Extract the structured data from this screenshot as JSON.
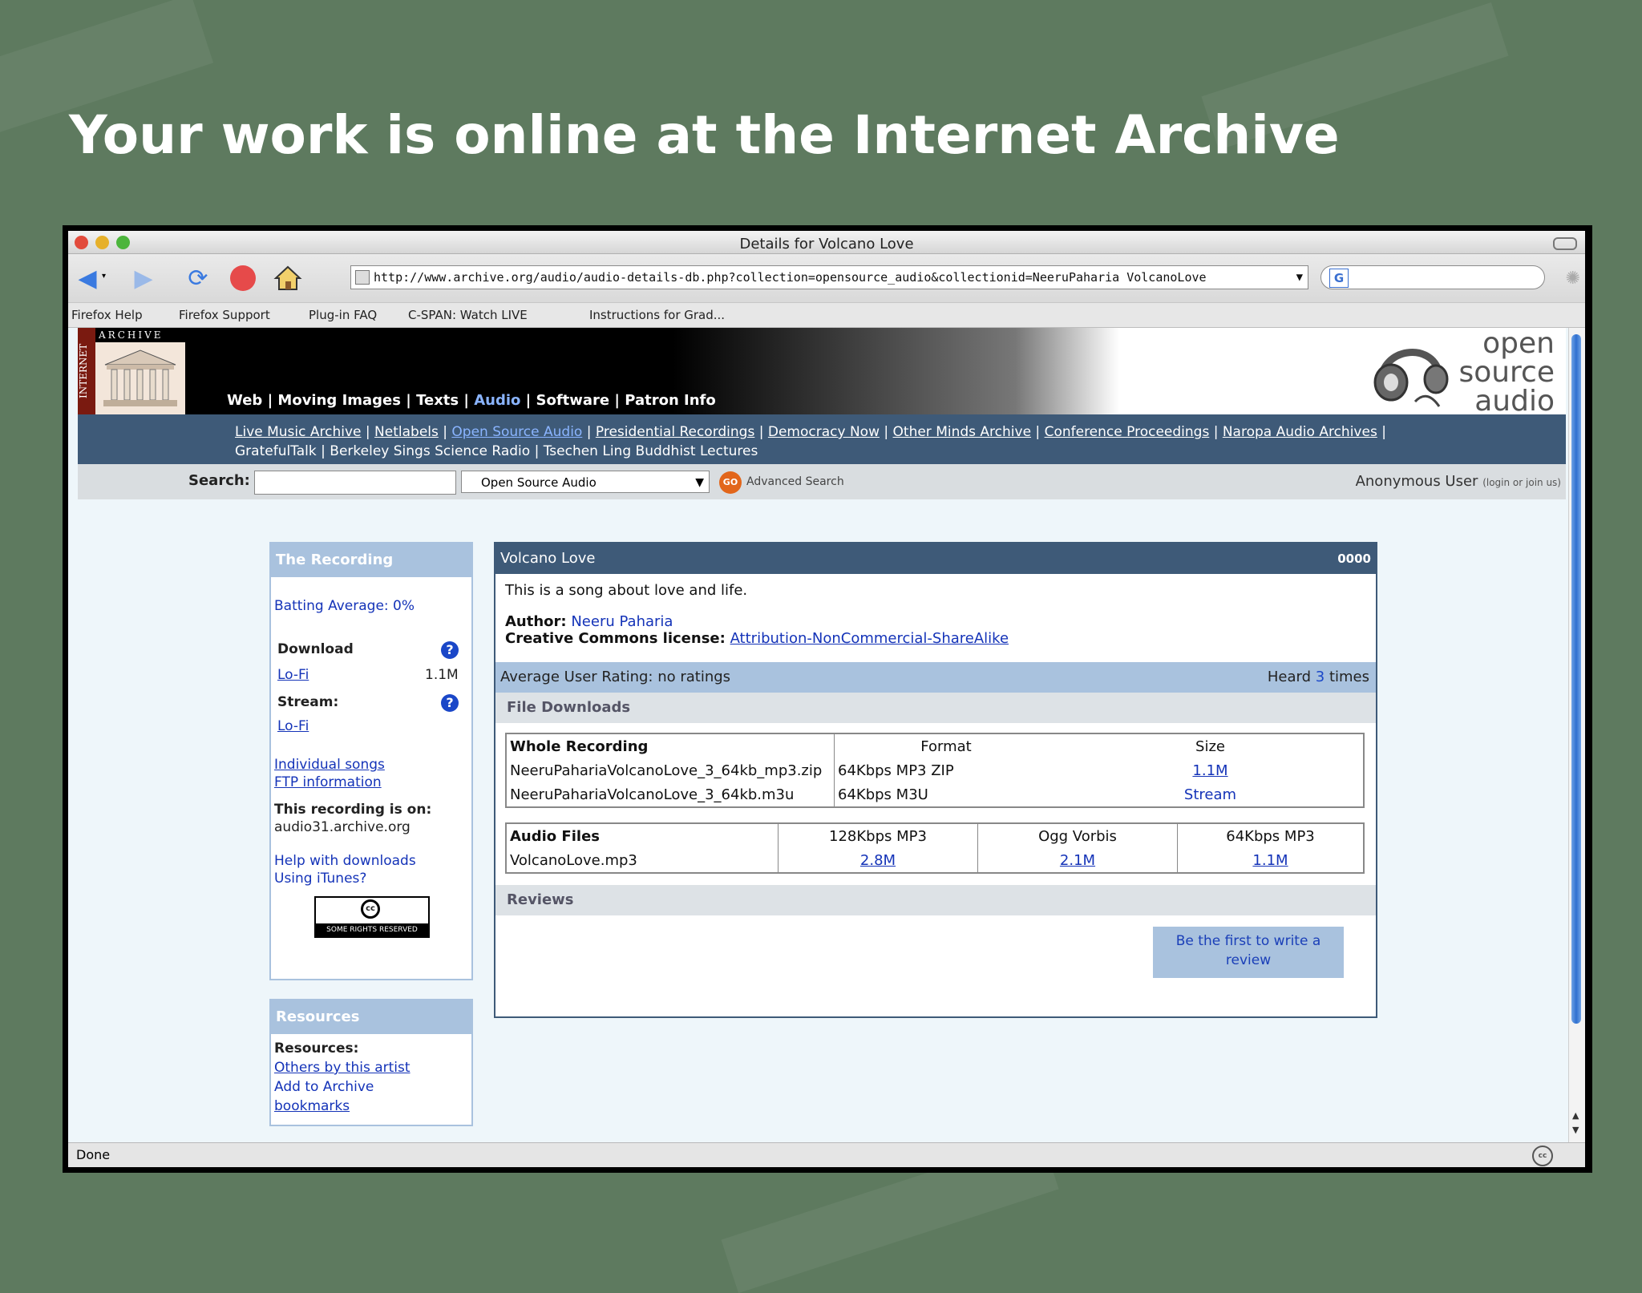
{
  "slide": {
    "title": "Your work is online at the Internet Archive"
  },
  "window": {
    "title": "Details for Volcano Love",
    "url": "http://www.archive.org/audio/audio-details-db.php?collection=opensource_audio&collectionid=NeeruPaharia VolcanoLove",
    "bookmarks": [
      "Firefox Help",
      "Firefox Support",
      "Plug-in FAQ",
      "C-SPAN: Watch LIVE",
      "Instructions for Grad..."
    ],
    "status": "Done",
    "colors": {
      "close": "#e24b3c",
      "minimize": "#e6b02a",
      "zoom": "#4cb53c"
    }
  },
  "site": {
    "logo": {
      "top": "ARCHIVE",
      "side": "INTERNET"
    },
    "nav": [
      "Web",
      "Moving Images",
      "Texts",
      "Audio",
      "Software",
      "Patron Info"
    ],
    "subnav": [
      "Live Music Archive",
      "Netlabels",
      "Open Source Audio",
      "Presidential Recordings",
      "Democracy Now",
      "Other Minds Archive",
      "Conference Proceedings",
      "Naropa Audio Archives",
      "GratefulTalk",
      "Berkeley Sings Science Radio",
      "Tsechen Ling Buddhist Lectures"
    ],
    "osa": {
      "line1": "open",
      "line2": "source",
      "line3": "audio"
    },
    "search": {
      "label": "Search:",
      "collection": "Open Source Audio",
      "go": "GO",
      "advanced": "Advanced Search",
      "user": "Anonymous User",
      "login": "(login or join us)"
    }
  },
  "recording": {
    "header": "The Recording",
    "batting": "Batting Average: 0%",
    "download_label": "Download",
    "lofi": "Lo-Fi",
    "lofi_size": "1.1M",
    "stream_label": "Stream:",
    "stream_lofi": "Lo-Fi",
    "individual": "Individual songs",
    "ftp": "FTP information",
    "on_label": "This recording is on:",
    "host": "audio31.archive.org",
    "help": "Help with downloads",
    "itunes": "Using iTunes?",
    "cc_badge": "SOME RIGHTS RESERVED"
  },
  "resources": {
    "header": "Resources",
    "label": "Resources:",
    "others": "Others by this artist",
    "add1": "Add to Archive",
    "add2": "bookmarks"
  },
  "main": {
    "title": "Volcano Love",
    "count": "0000",
    "description": "This is a song about love and life.",
    "author_label": "Author:",
    "author": "Neeru Paharia",
    "license_label": "Creative Commons license:",
    "license": "Attribution-NonCommercial-ShareAlike",
    "rating": "Average User Rating: no ratings",
    "heard_prefix": "Heard",
    "heard_count": "3",
    "heard_suffix": "times",
    "downloads_header": "File Downloads",
    "whole": {
      "headers": [
        "Whole Recording",
        "Format",
        "Size"
      ],
      "rows": [
        {
          "file": "NeeruPahariaVolcanoLove_3_64kb_mp3.zip",
          "format": "64Kbps MP3 ZIP",
          "size": "1.1M"
        },
        {
          "file": "NeeruPahariaVolcanoLove_3_64kb.m3u",
          "format": "64Kbps M3U",
          "size": "Stream"
        }
      ]
    },
    "audio": {
      "headers": [
        "Audio Files",
        "128Kbps MP3",
        "Ogg Vorbis",
        "64Kbps MP3"
      ],
      "row": {
        "file": "VolcanoLove.mp3",
        "mp3128": "2.8M",
        "ogg": "2.1M",
        "mp364": "1.1M"
      }
    },
    "reviews_header": "Reviews",
    "review_btn": "Be the first to write a review"
  }
}
